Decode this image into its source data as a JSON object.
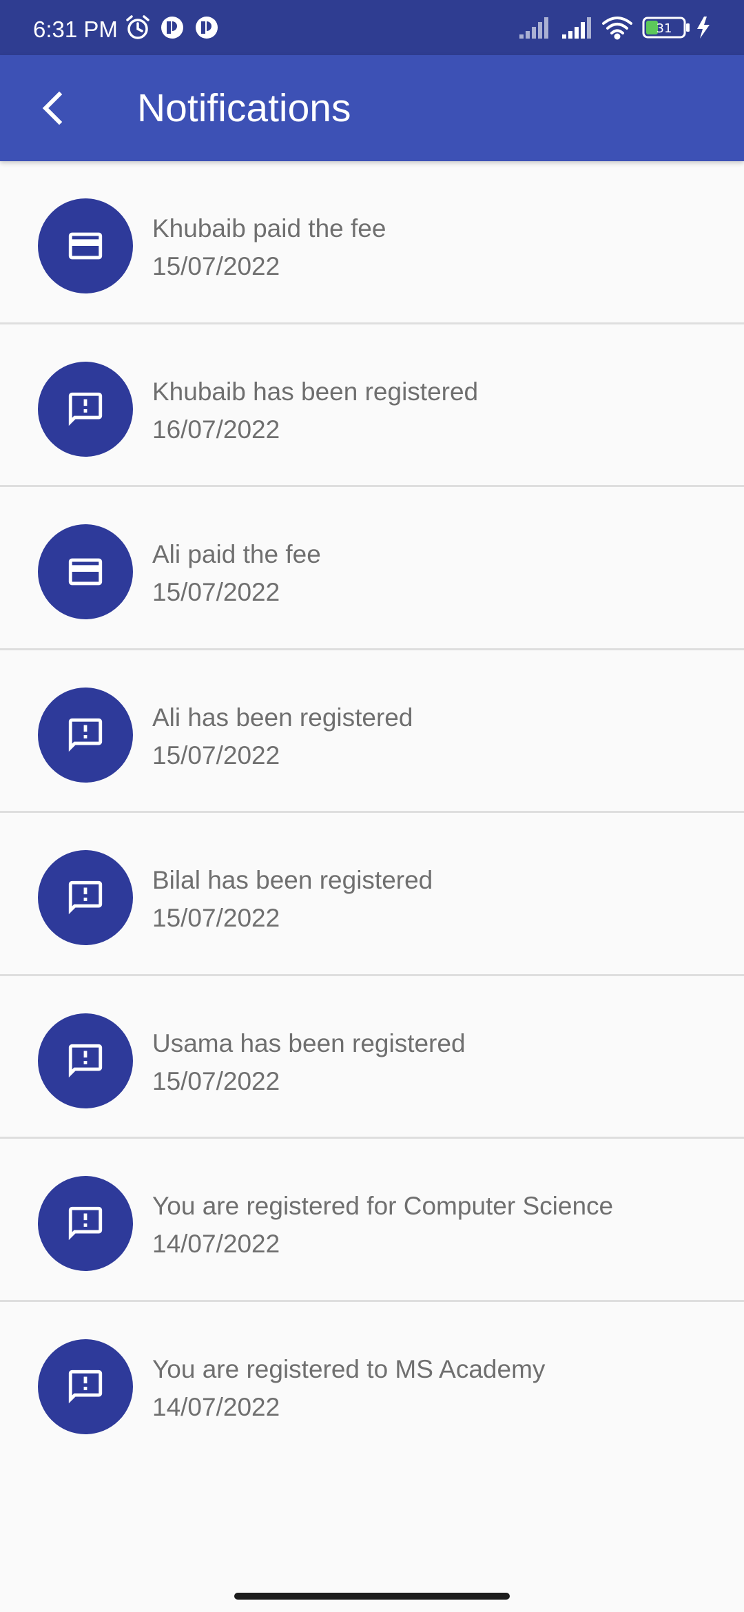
{
  "status_bar": {
    "time": "6:31 PM",
    "battery_level": "31",
    "icons": [
      "alarm-icon",
      "app-notification-icon",
      "app-notification-icon",
      "signal-icon",
      "signal-icon",
      "wifi-icon",
      "battery-icon",
      "charging-icon"
    ]
  },
  "header": {
    "title": "Notifications",
    "back_icon": "arrow-back-icon"
  },
  "notifications": [
    {
      "icon": "credit-card-icon",
      "title": "Khubaib paid the fee",
      "date": "15/07/2022"
    },
    {
      "icon": "feedback-alert-icon",
      "title": "Khubaib has been registered",
      "date": "16/07/2022"
    },
    {
      "icon": "credit-card-icon",
      "title": "Ali paid the fee",
      "date": "15/07/2022"
    },
    {
      "icon": "feedback-alert-icon",
      "title": "Ali has been registered",
      "date": "15/07/2022"
    },
    {
      "icon": "feedback-alert-icon",
      "title": "Bilal has been registered",
      "date": "15/07/2022"
    },
    {
      "icon": "feedback-alert-icon",
      "title": "Usama has been registered",
      "date": "15/07/2022"
    },
    {
      "icon": "feedback-alert-icon",
      "title": "You are registered for Computer Science",
      "date": "14/07/2022"
    },
    {
      "icon": "feedback-alert-icon",
      "title": "You are registered to MS Academy",
      "date": "14/07/2022"
    }
  ],
  "colors": {
    "status_bar": "#2f3d91",
    "app_bar": "#3d51b5",
    "avatar": "#2e3a9a",
    "text": "#6f6f6f",
    "background": "#fafafa",
    "divider": "#dedede"
  }
}
